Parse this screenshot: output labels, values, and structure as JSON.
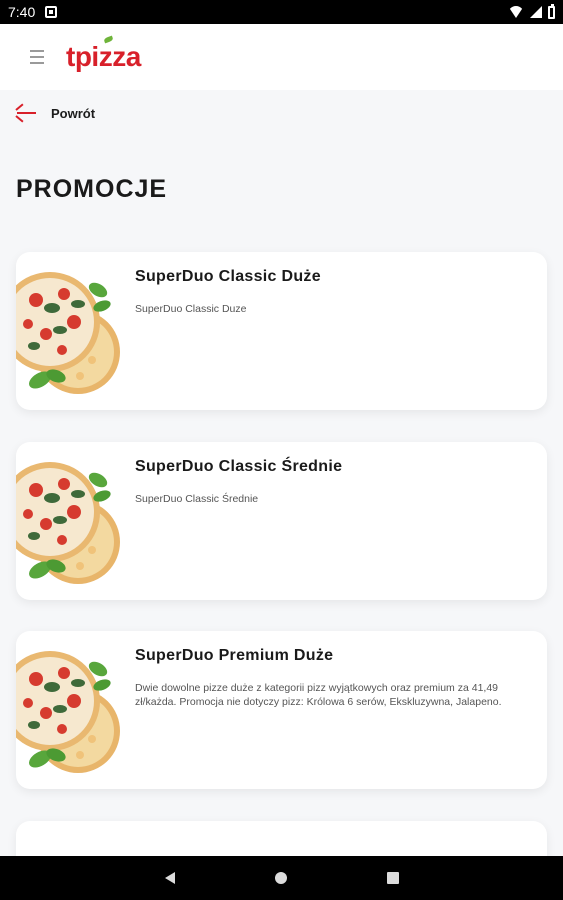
{
  "status_bar": {
    "time": "7:40"
  },
  "header": {
    "logo_text": "tpizza",
    "brand_color": "#d8202a",
    "leaf_color": "#6fb43a"
  },
  "back": {
    "label": "Powrót",
    "icon": "arrow-left-icon"
  },
  "page": {
    "title": "PROMOCJE"
  },
  "promotions": [
    {
      "name": "SuperDuo Classic Duże",
      "description": "SuperDuo Classic Duze"
    },
    {
      "name": "SuperDuo Classic Średnie",
      "description": "SuperDuo Classic Średnie"
    },
    {
      "name": "SuperDuo Premium Duże",
      "description": "Dwie dowolne pizze duże z kategorii pizz wyjątkowych oraz premium za 41,49 zł/każda. Promocja nie dotyczy pizz: Królowa 6 serów, Ekskluzywna, Jalapeno."
    }
  ]
}
